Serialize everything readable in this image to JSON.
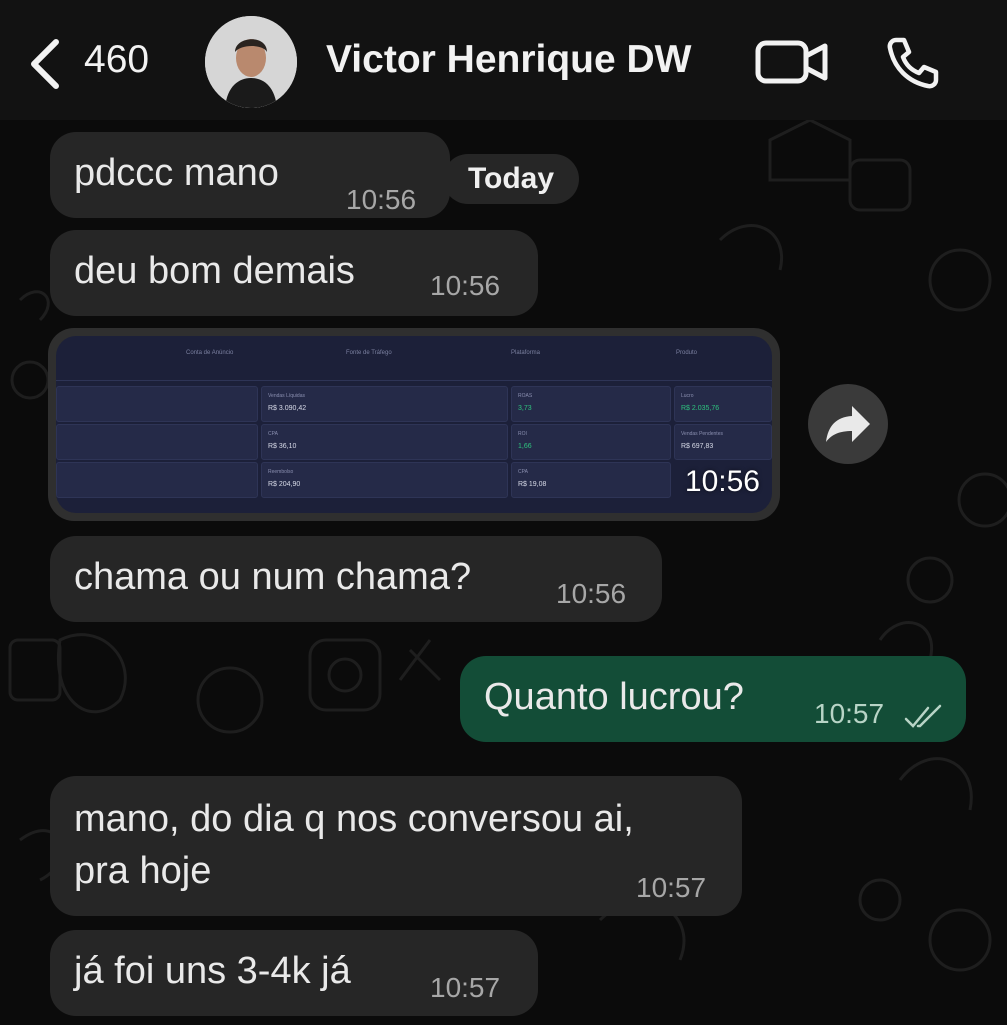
{
  "header": {
    "back_count": "460",
    "contact_name": "Victor Henrique DW"
  },
  "date_pill": "Today",
  "messages": [
    {
      "text": "pdccc mano",
      "time": "10:56",
      "direction": "incoming"
    },
    {
      "text": "deu bom demais",
      "time": "10:56",
      "direction": "incoming"
    },
    {
      "text": "",
      "time": "10:56",
      "direction": "incoming",
      "type": "image"
    },
    {
      "text": "chama ou num chama?",
      "time": "10:56",
      "direction": "incoming"
    },
    {
      "text": "Quanto lucrou?",
      "time": "10:57",
      "direction": "outgoing",
      "status": "read"
    },
    {
      "text": "mano, do dia q nos conversou ai,",
      "text2": "pra hoje",
      "time": "10:57",
      "direction": "incoming"
    },
    {
      "text": "já foi uns 3-4k já",
      "time": "10:57",
      "direction": "incoming"
    }
  ],
  "image_content": {
    "values": [
      "R$ 3.090,42",
      "R$ 36,10",
      "R$ 204,90",
      "3,73",
      "1,66",
      "R$ 19,08",
      "R$ 2.035,76",
      "R$ 697,83"
    ]
  },
  "colors": {
    "background": "#0b0b0b",
    "incoming_bubble": "#262626",
    "outgoing_bubble": "#134d37",
    "read_ticks": "#b8d4c6"
  }
}
